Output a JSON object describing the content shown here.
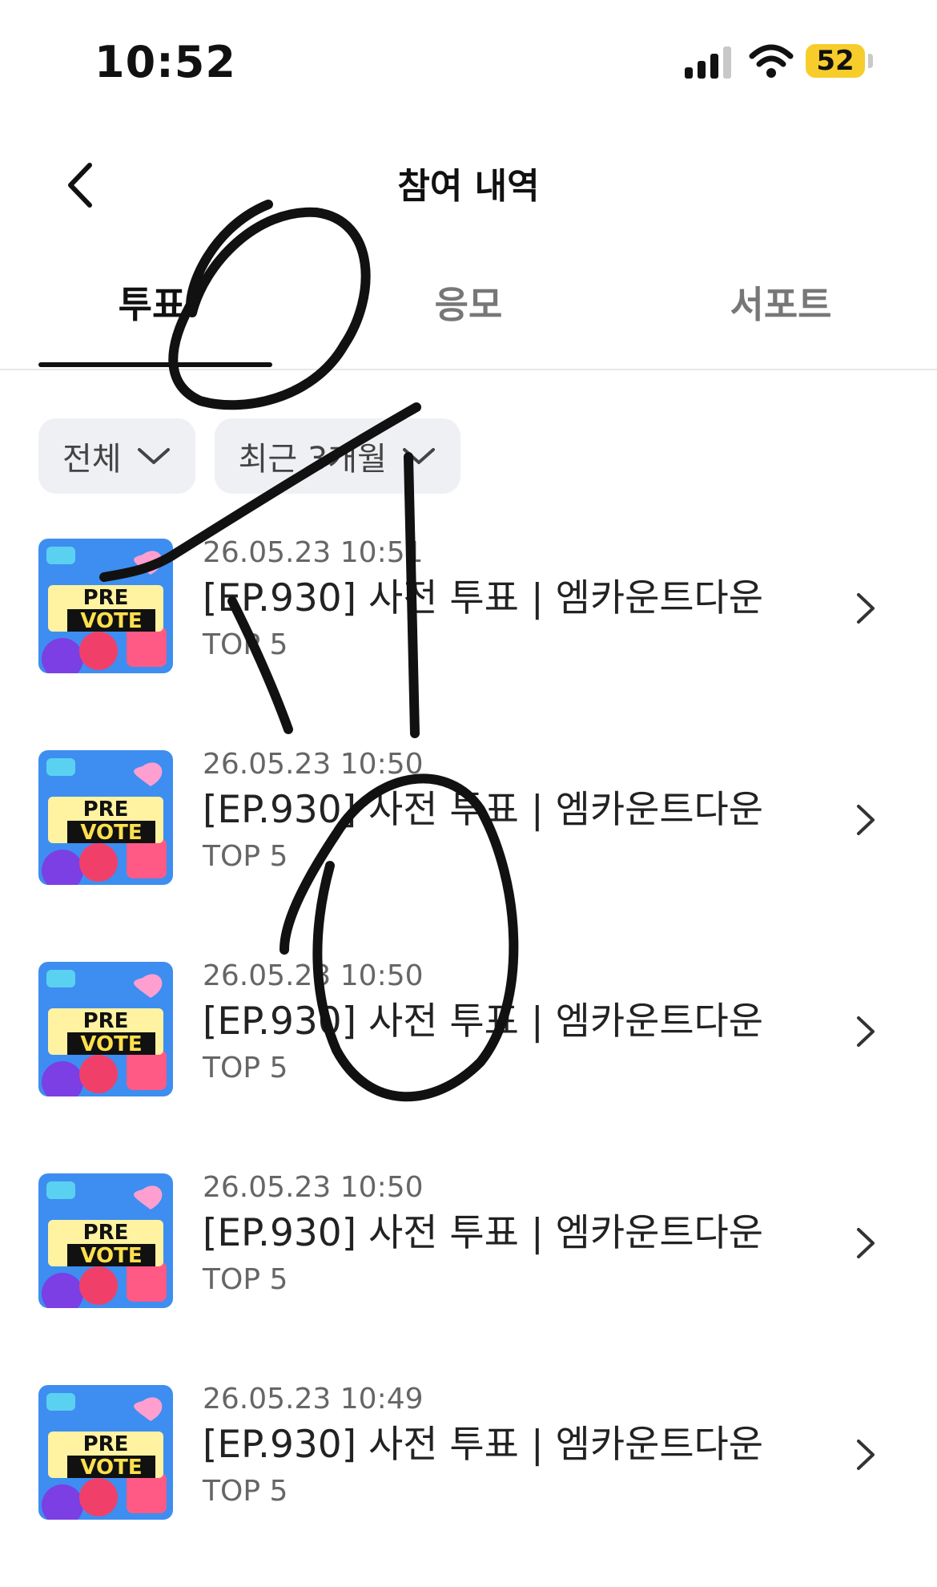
{
  "status_bar": {
    "time": "10:52",
    "battery": "52",
    "icons": [
      "signal-icon",
      "wifi-icon",
      "battery-icon"
    ],
    "battery_color": "#f6cd2b"
  },
  "header": {
    "title": "참여 내역",
    "back_icon": "chevron-left-icon"
  },
  "tabs": [
    {
      "label": "투표",
      "active": true
    },
    {
      "label": "응모",
      "active": false
    },
    {
      "label": "서포트",
      "active": false
    }
  ],
  "filters": [
    {
      "label": "전체"
    },
    {
      "label": "최근 3개월"
    }
  ],
  "items": [
    {
      "date": "26.05.23 10:51",
      "title": "[EP.930] 사전 투표 | 엠카운트다운",
      "subtitle": "TOP 5"
    },
    {
      "date": "26.05.23 10:50",
      "title": "[EP.930] 사전 투표 | 엠카운트다운",
      "subtitle": "TOP 5"
    },
    {
      "date": "26.05.23 10:50",
      "title": "[EP.930] 사전 투표 | 엠카운트다운",
      "subtitle": "TOP 5"
    },
    {
      "date": "26.05.23 10:50",
      "title": "[EP.930] 사전 투표 | 엠카운트다운",
      "subtitle": "TOP 5"
    },
    {
      "date": "26.05.23 10:49",
      "title": "[EP.930] 사전 투표 | 엠카운트다운",
      "subtitle": "TOP 5"
    }
  ],
  "thumbnail": {
    "line1": "PRE",
    "line2": "VOTE"
  },
  "annotation": "handwritten-scribble"
}
